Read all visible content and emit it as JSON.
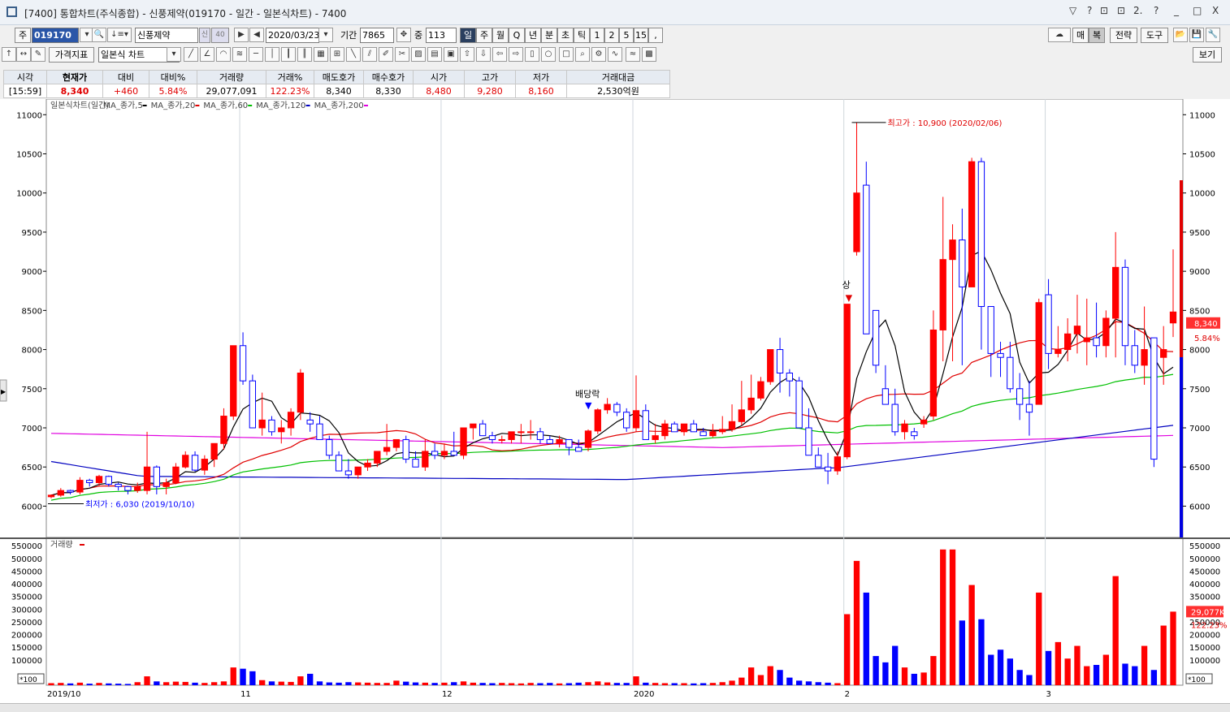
{
  "window": {
    "title": "[7400] 통합차트(주식종합) - 신풍제약(019170 - 일간 - 일본식차트) - 7400",
    "controls": [
      "▽",
      "?",
      "⊡",
      "⊡",
      "2.",
      "?",
      "_",
      "□",
      "X"
    ]
  },
  "toolbar1": {
    "market": "주",
    "code": "019170",
    "name": "신풍제약",
    "badge1": "신",
    "badge2": "40",
    "date": "2020/03/23",
    "period_label": "기간",
    "period_value": "7865",
    "count_label": "중",
    "count_value": "113",
    "tabs": [
      "일",
      "주",
      "월",
      "Q",
      "년",
      "분",
      "초",
      "틱",
      "1",
      "2",
      "5",
      "15"
    ],
    "right_buttons": [
      "매",
      "복",
      "전략",
      "도구"
    ]
  },
  "toolbar2": {
    "indicator_btn": "가격지표",
    "chart_type": "일본식 차트",
    "view_btn": "보기"
  },
  "quote": {
    "headers": [
      "시각",
      "현재가",
      "대비",
      "대비%",
      "거래량",
      "거래%",
      "매도호가",
      "매수호가",
      "시가",
      "고가",
      "저가",
      "거래대금"
    ],
    "values": [
      "[15:59]",
      "8,340",
      "+460",
      "5.84%",
      "29,077,091",
      "122.23%",
      "8,340",
      "8,330",
      "8,480",
      "9,280",
      "8,160",
      "2,530억원"
    ]
  },
  "chart_data": {
    "type": "candlestick",
    "legend_price": [
      "일본식차트(일간)",
      "MA_종가,5",
      "MA_종가,20",
      "MA_종가,60",
      "MA_종가,120",
      "MA_종가,200"
    ],
    "legend_volume": "거래량",
    "price_axis": {
      "min": 5600,
      "max": 11200,
      "ticks": [
        6000,
        6500,
        7000,
        7500,
        8000,
        8500,
        9000,
        9500,
        10000,
        10500,
        11000
      ]
    },
    "volume_axis": {
      "max": 560000,
      "ticks": [
        100000,
        150000,
        200000,
        250000,
        300000,
        350000,
        400000,
        450000,
        500000,
        550000
      ],
      "unit_label": "*100"
    },
    "x_labels": [
      "2019/10",
      "11",
      "12",
      "2020",
      "2",
      "3"
    ],
    "annotations": {
      "high": "최고가 : 10,900 (2020/02/06)",
      "low": "최저가 : 6,030 (2019/10/10)",
      "upper_limit": "상",
      "dividend": "배당락"
    },
    "current_price_tag": "8,340",
    "current_change_tag": "5.84%",
    "volume_tag": "29,077K",
    "volume_pct_tag": "122.23%",
    "candles": [
      [
        6120,
        6150,
        6100,
        6140
      ],
      [
        6140,
        6230,
        6120,
        6200
      ],
      [
        6200,
        6210,
        6150,
        6180
      ],
      [
        6180,
        6370,
        6150,
        6330
      ],
      [
        6330,
        6350,
        6250,
        6300
      ],
      [
        6300,
        6400,
        6260,
        6380
      ],
      [
        6380,
        6390,
        6250,
        6280
      ],
      [
        6280,
        6300,
        6200,
        6250
      ],
      [
        6250,
        6260,
        6150,
        6200
      ],
      [
        6200,
        6300,
        6170,
        6250
      ],
      [
        6200,
        6950,
        6150,
        6500
      ],
      [
        6500,
        6520,
        6150,
        6250
      ],
      [
        6250,
        6350,
        6150,
        6300
      ],
      [
        6300,
        6550,
        6280,
        6500
      ],
      [
        6500,
        6700,
        6480,
        6650
      ],
      [
        6650,
        6700,
        6440,
        6460
      ],
      [
        6460,
        6650,
        6400,
        6600
      ],
      [
        6600,
        6750,
        6500,
        6800
      ],
      [
        6800,
        7250,
        6720,
        7150
      ],
      [
        7150,
        7750,
        7100,
        8050
      ],
      [
        8050,
        8220,
        7550,
        7600
      ],
      [
        7600,
        7680,
        7200,
        7000
      ],
      [
        7000,
        7450,
        6900,
        7100
      ],
      [
        7100,
        7150,
        6900,
        6950
      ],
      [
        6950,
        7100,
        6800,
        7000
      ],
      [
        7000,
        7250,
        6900,
        7200
      ],
      [
        7200,
        7750,
        7100,
        7700
      ],
      [
        7100,
        7200,
        6950,
        7050
      ],
      [
        7050,
        7150,
        6850,
        6850
      ],
      [
        6850,
        6900,
        6600,
        6650
      ],
      [
        6650,
        6700,
        6550,
        6450
      ],
      [
        6450,
        6600,
        6350,
        6400
      ],
      [
        6400,
        6500,
        6350,
        6500
      ],
      [
        6500,
        6600,
        6450,
        6550
      ],
      [
        6550,
        6650,
        6500,
        6700
      ],
      [
        6700,
        7050,
        6650,
        6750
      ],
      [
        6750,
        6850,
        6700,
        6850
      ],
      [
        6850,
        6900,
        6550,
        6600
      ],
      [
        6600,
        6700,
        6500,
        6500
      ],
      [
        6500,
        6850,
        6450,
        6700
      ],
      [
        6700,
        6800,
        6600,
        6650
      ],
      [
        6650,
        6800,
        6600,
        6700
      ],
      [
        6700,
        6950,
        6650,
        6650
      ],
      [
        6650,
        7000,
        6600,
        7000
      ],
      [
        7000,
        7050,
        6850,
        7050
      ],
      [
        7050,
        7100,
        6900,
        6900
      ],
      [
        6900,
        6950,
        6800,
        6850
      ],
      [
        6850,
        6900,
        6800,
        6850
      ],
      [
        6850,
        6950,
        6800,
        6950
      ],
      [
        6950,
        7050,
        6800,
        6950
      ],
      [
        6950,
        7100,
        6850,
        6950
      ],
      [
        6950,
        7000,
        6800,
        6850
      ],
      [
        6850,
        6900,
        6800,
        6800
      ],
      [
        6800,
        6900,
        6750,
        6850
      ],
      [
        6850,
        6850,
        6650,
        6750
      ],
      [
        6750,
        6850,
        6700,
        6700
      ],
      [
        6750,
        6980,
        6700,
        6960
      ],
      [
        6960,
        7250,
        6920,
        7230
      ],
      [
        7230,
        7380,
        7180,
        7300
      ],
      [
        7300,
        7330,
        7150,
        7200
      ],
      [
        7200,
        7250,
        6950,
        7000
      ],
      [
        7000,
        7670,
        6950,
        7220
      ],
      [
        7220,
        7300,
        6900,
        6850
      ],
      [
        6850,
        7050,
        6800,
        6900
      ],
      [
        6900,
        7100,
        6850,
        7050
      ],
      [
        7050,
        7080,
        6950,
        6950
      ],
      [
        6950,
        7050,
        6900,
        7050
      ],
      [
        7050,
        7100,
        6950,
        6950
      ],
      [
        6950,
        7000,
        6900,
        6900
      ],
      [
        6900,
        7050,
        6880,
        6950
      ],
      [
        6950,
        7150,
        6920,
        6980
      ],
      [
        6980,
        7300,
        6950,
        7080
      ],
      [
        7080,
        7600,
        7030,
        7230
      ],
      [
        7230,
        7680,
        7180,
        7380
      ],
      [
        7380,
        7650,
        7350,
        7590
      ],
      [
        7590,
        7900,
        7550,
        8000
      ],
      [
        8000,
        8150,
        7450,
        7700
      ],
      [
        7700,
        7750,
        7400,
        7600
      ],
      [
        7600,
        7650,
        7200,
        7000
      ],
      [
        7000,
        7250,
        6900,
        6650
      ],
      [
        6650,
        6750,
        6550,
        6500
      ],
      [
        6500,
        6680,
        6280,
        6450
      ],
      [
        6450,
        6700,
        6400,
        6630
      ],
      [
        6630,
        8580,
        6600,
        8580
      ],
      [
        9250,
        10900,
        9200,
        10000
      ],
      [
        10100,
        10400,
        8400,
        8200
      ],
      [
        8500,
        8500,
        7700,
        7800
      ],
      [
        7500,
        7800,
        7450,
        7300
      ],
      [
        7300,
        7500,
        6900,
        6950
      ],
      [
        6950,
        7100,
        6850,
        7050
      ],
      [
        6950,
        7000,
        6850,
        6900
      ],
      [
        7050,
        7150,
        7000,
        7100
      ],
      [
        7150,
        8500,
        7100,
        8250
      ],
      [
        8250,
        9950,
        7850,
        9150
      ],
      [
        9150,
        9600,
        7850,
        9400
      ],
      [
        9400,
        9800,
        7800,
        8800
      ],
      [
        8800,
        10450,
        8800,
        10400
      ],
      [
        10400,
        10450,
        8000,
        8550
      ],
      [
        8550,
        8550,
        7650,
        7950
      ],
      [
        7950,
        8100,
        7650,
        7900
      ],
      [
        7900,
        8100,
        7450,
        7500
      ],
      [
        7500,
        7700,
        7100,
        7300
      ],
      [
        7300,
        7600,
        6900,
        7200
      ],
      [
        7300,
        8650,
        7300,
        8600
      ],
      [
        8700,
        8900,
        7750,
        7950
      ],
      [
        7950,
        8300,
        7900,
        8000
      ],
      [
        8000,
        8400,
        7850,
        8200
      ],
      [
        8200,
        8700,
        7950,
        8300
      ],
      [
        8100,
        8650,
        7800,
        8150
      ],
      [
        8150,
        8600,
        7900,
        8050
      ],
      [
        8050,
        8500,
        7900,
        8400
      ],
      [
        8400,
        9500,
        7900,
        9050
      ],
      [
        9050,
        9150,
        7800,
        8050
      ],
      [
        8050,
        8250,
        7700,
        7800
      ],
      [
        7800,
        8550,
        7550,
        8000
      ],
      [
        8150,
        8150,
        6500,
        6600
      ],
      [
        7900,
        8300,
        7550,
        8000
      ],
      [
        8340,
        9280,
        8160,
        8480
      ]
    ],
    "volumes": [
      8000,
      9000,
      7000,
      10000,
      6000,
      9000,
      7000,
      6000,
      5000,
      12000,
      35000,
      15000,
      12000,
      14000,
      13000,
      10000,
      9000,
      12000,
      15000,
      70000,
      65000,
      55000,
      20000,
      15000,
      14000,
      13000,
      35000,
      45000,
      15000,
      11000,
      10000,
      12000,
      11000,
      10000,
      9000,
      9000,
      18000,
      14000,
      11000,
      10000,
      9000,
      10000,
      12000,
      15000,
      10000,
      9000,
      8000,
      9000,
      8000,
      7000,
      9000,
      8000,
      9000,
      7000,
      8000,
      10000,
      12000,
      15000,
      11000,
      9000,
      9000,
      35000,
      10000,
      9000,
      8000,
      8000,
      8000,
      7000,
      8000,
      9000,
      12000,
      18000,
      30000,
      70000,
      40000,
      75000,
      60000,
      30000,
      18000,
      15000,
      12000,
      10000,
      8000,
      280000,
      490000,
      365000,
      115000,
      90000,
      155000,
      70000,
      45000,
      50000,
      115000,
      535000,
      535000,
      255000,
      395000,
      260000,
      120000,
      140000,
      105000,
      60000,
      40000,
      365000,
      135000,
      170000,
      105000,
      155000,
      75000,
      80000,
      120000,
      430000,
      85000,
      75000,
      155000,
      60000,
      235000,
      290000
    ],
    "ma_lines": {
      "ma5": "black",
      "ma20": "red",
      "ma60": "green",
      "ma120": "blue",
      "ma200": "magenta"
    }
  }
}
